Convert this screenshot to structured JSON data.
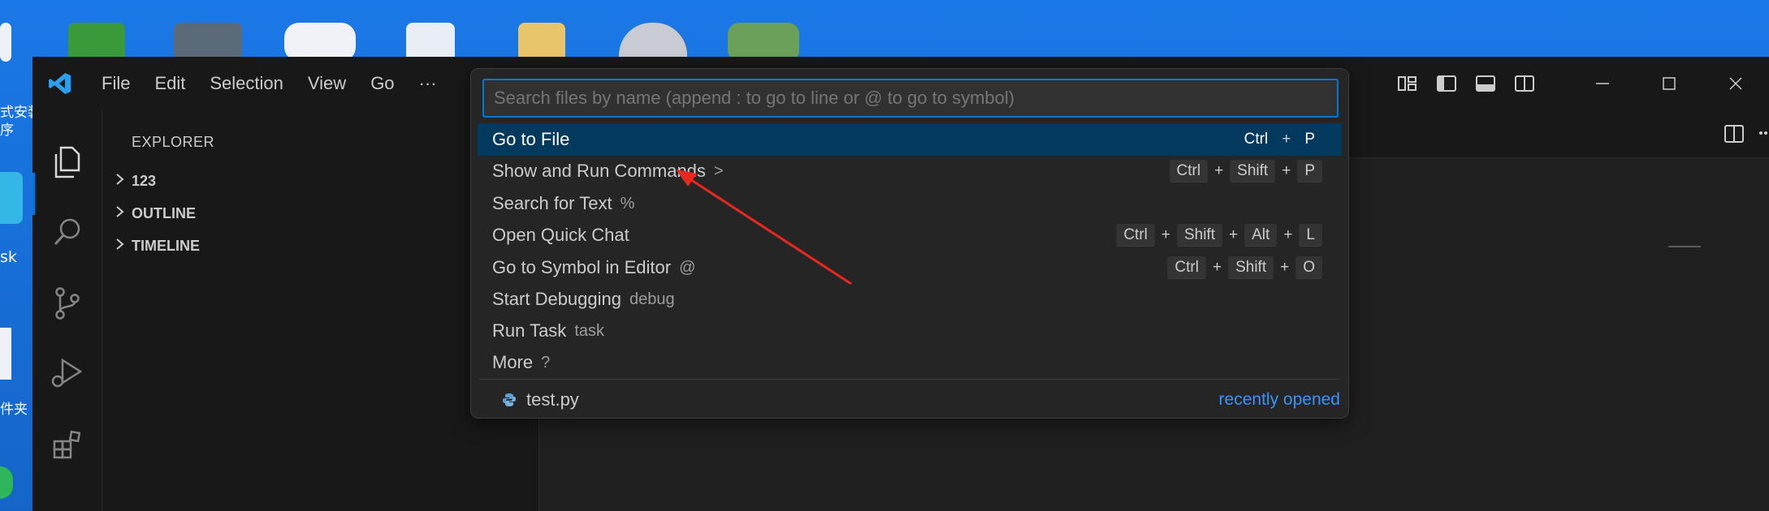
{
  "menu": {
    "file": "File",
    "edit": "Edit",
    "selection": "Selection",
    "view": "View",
    "go": "Go",
    "more": "···"
  },
  "desktop": {
    "label1": "式安装\n序",
    "label2": "sk",
    "label3": "件夹"
  },
  "sidebar": {
    "header": "EXPLORER",
    "folder": "123",
    "outline": "OUTLINE",
    "timeline": "TIMELINE"
  },
  "quick_pick": {
    "placeholder": "Search files by name (append : to go to line or @ to go to symbol)",
    "items": [
      {
        "label": "Go to File",
        "suffix": "",
        "keys": [
          "Ctrl",
          "P"
        ]
      },
      {
        "label": "Show and Run Commands",
        "suffix": ">",
        "keys": [
          "Ctrl",
          "Shift",
          "P"
        ]
      },
      {
        "label": "Search for Text",
        "suffix": "%",
        "keys": []
      },
      {
        "label": "Open Quick Chat",
        "suffix": "",
        "keys": [
          "Ctrl",
          "Shift",
          "Alt",
          "L"
        ]
      },
      {
        "label": "Go to Symbol in Editor",
        "suffix": "@",
        "keys": [
          "Ctrl",
          "Shift",
          "O"
        ]
      },
      {
        "label": "Start Debugging",
        "suffix": "debug",
        "keys": []
      },
      {
        "label": "Run Task",
        "suffix": "task",
        "keys": []
      },
      {
        "label": "More",
        "suffix": "?",
        "keys": []
      }
    ],
    "plus": "+",
    "recent": {
      "file": "test.py",
      "label": "recently opened"
    }
  },
  "colors": {
    "accent": "#0078d4",
    "selection": "#04395e",
    "link": "#3794ff",
    "arrow": "#e8281e",
    "desktop": "#1a78e6"
  }
}
